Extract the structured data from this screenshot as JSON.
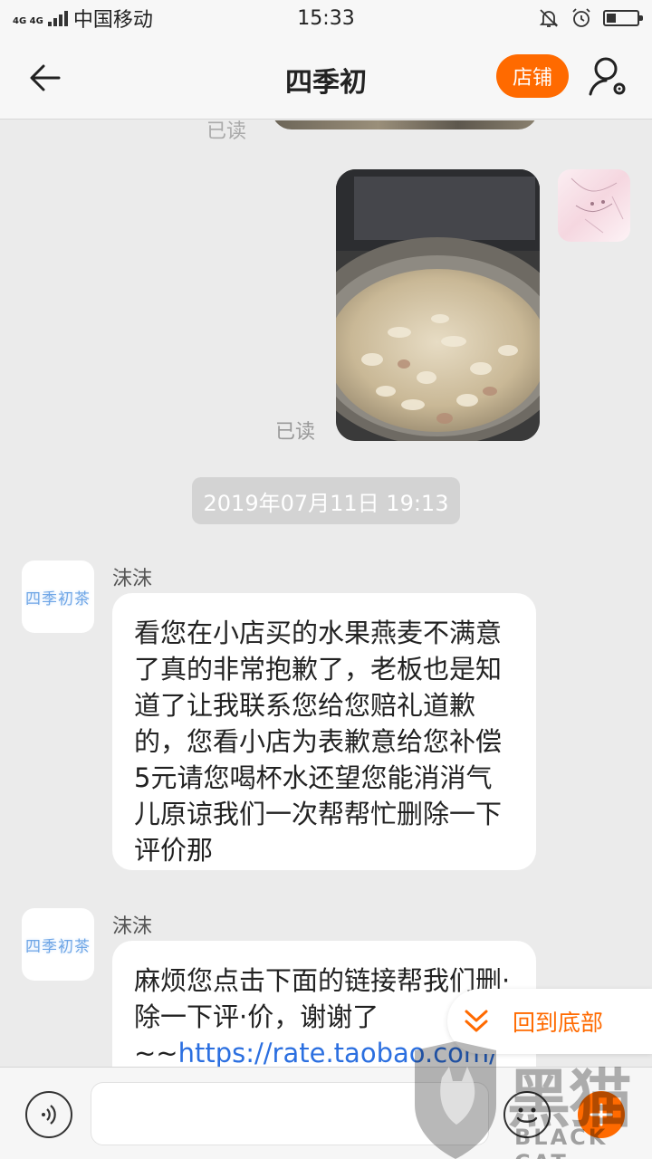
{
  "status_bar": {
    "network": "4G 4G",
    "carrier": "中国移动",
    "time": "15:33"
  },
  "header": {
    "title": "四季初",
    "shop_label": "店铺"
  },
  "chat": {
    "prev_read": "已读",
    "read_mark": "已读",
    "timestamp": "2019年07月11日 19:13",
    "messages": [
      {
        "sender": "沫沫",
        "avatar_text": "四季初茶",
        "text": "看您在小店买的水果燕麦不满意了真的非常抱歉了，老板也是知道了让我联系您给您赔礼道歉的，您看小店为表歉意给您补偿5元请您喝杯水还望您能消消气儿原谅我们一次帮帮忙删除一下评价那"
      },
      {
        "sender": "沫沫",
        "avatar_text": "四季初茶",
        "text": "麻烦您点击下面的链接帮我们删·除一下评·价，谢谢了~~",
        "link": "https://rate.taobao.com/"
      }
    ]
  },
  "to_bottom_label": "回到底部",
  "watermark": {
    "cn": "黑猫",
    "en": "BLACK CAT"
  },
  "colors": {
    "accent": "#ff6a00",
    "link": "#2b6fe0",
    "background": "#ebebeb"
  }
}
